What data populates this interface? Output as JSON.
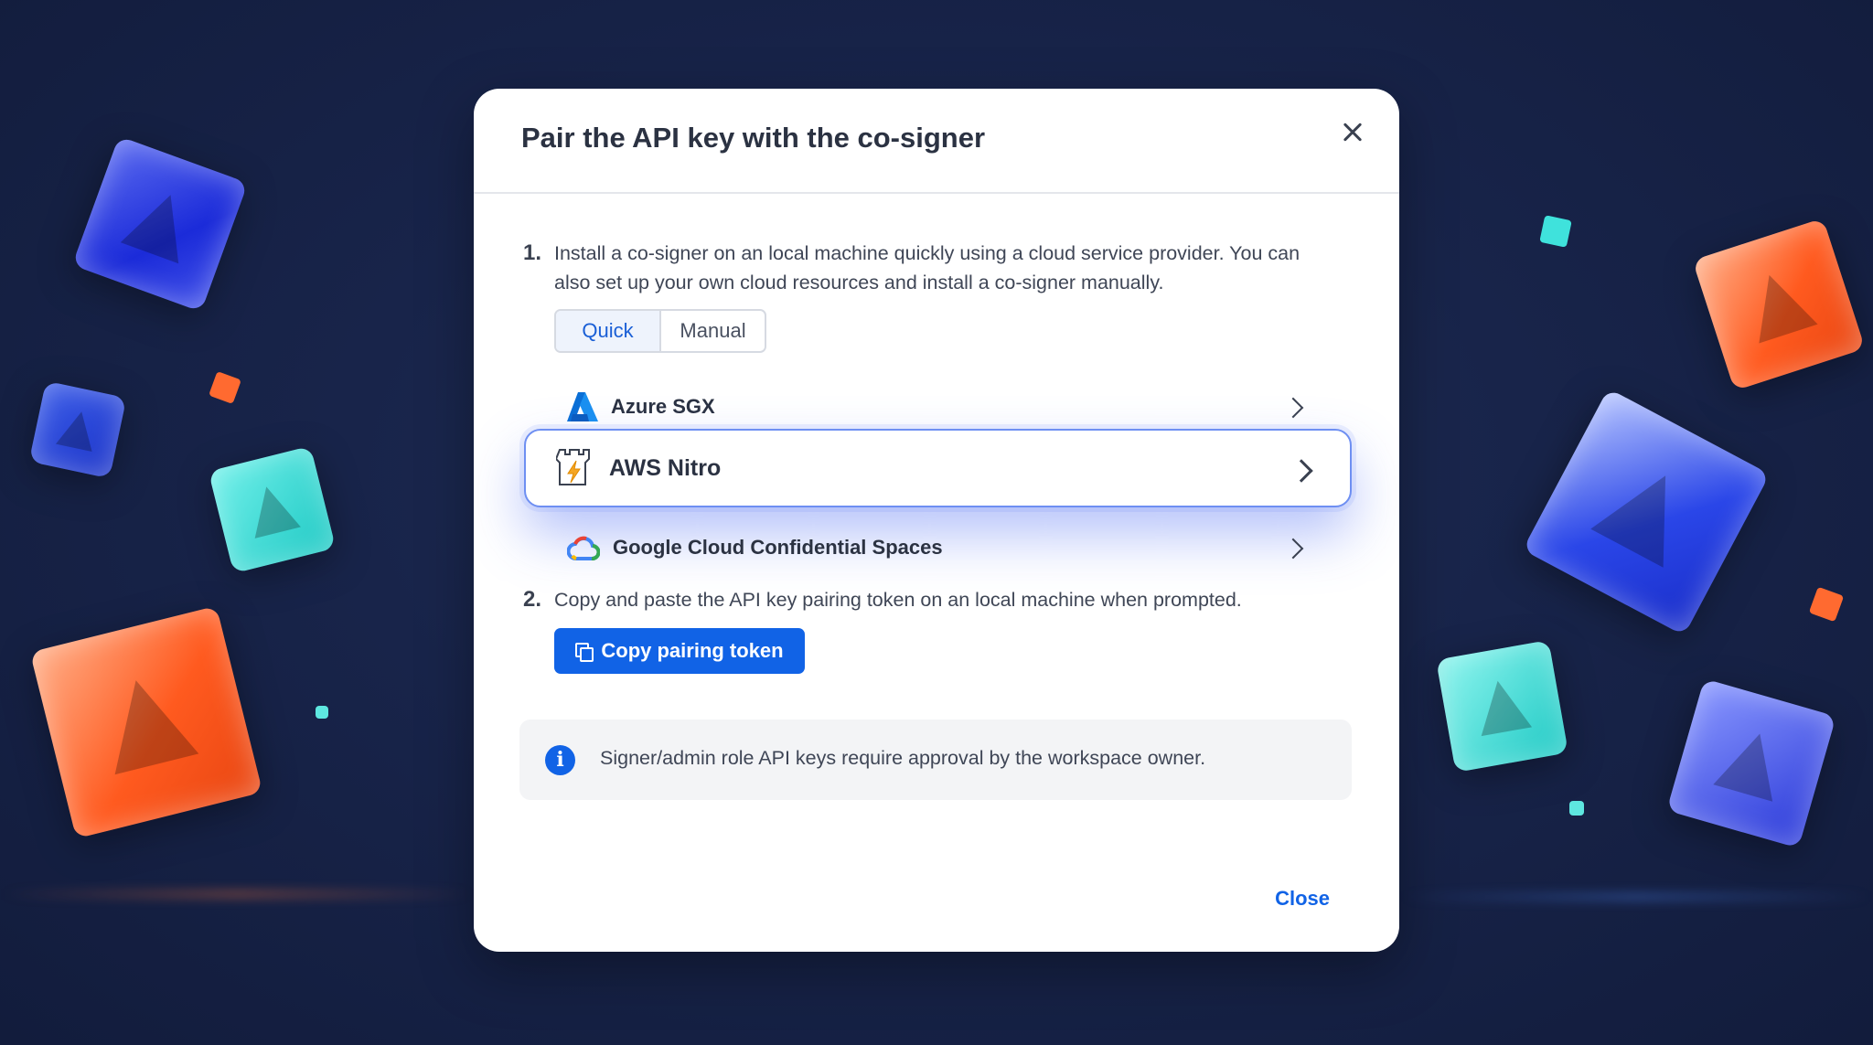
{
  "modal": {
    "title": "Pair the API key with the co-signer",
    "close_icon": "close-icon"
  },
  "step1": {
    "number": "1.",
    "text_line1": "Install a co-signer on an local machine quickly using a cloud service provider. You can",
    "text_line2": "also set up your own cloud resources and install a co-signer manually.",
    "tabs": [
      {
        "label": "Quick",
        "active": true
      },
      {
        "label": "Manual",
        "active": false
      }
    ],
    "providers": [
      {
        "name": "Azure SGX",
        "icon": "azure-icon",
        "selected": false
      },
      {
        "name": "AWS Nitro",
        "icon": "aws-nitro-icon",
        "selected": true
      },
      {
        "name": "Google Cloud Confidential Spaces",
        "icon": "google-cloud-icon",
        "selected": false
      }
    ]
  },
  "step2": {
    "number": "2.",
    "text": "Copy and paste the API key pairing token on an local machine when prompted.",
    "copy_button_label": "Copy pairing token",
    "copy_icon": "copy-icon"
  },
  "info": {
    "icon": "info-icon",
    "text": "Signer/admin role API keys require approval by the workspace owner."
  },
  "footer": {
    "close_label": "Close"
  },
  "colors": {
    "accent": "#1163e6",
    "background": "#18244a",
    "selected_border": "#6e8ff2"
  }
}
